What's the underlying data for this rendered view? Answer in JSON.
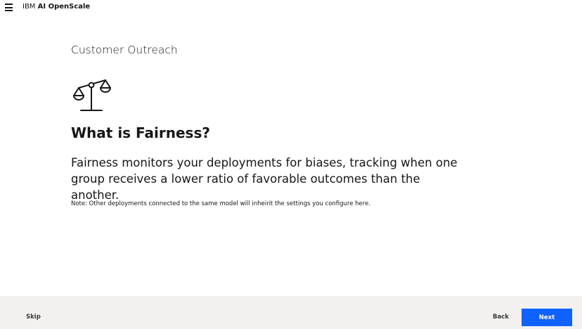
{
  "header": {
    "brand_prefix": "IBM",
    "brand_name": "AI OpenScale",
    "menu_icon": "hamburger-menu-icon"
  },
  "main": {
    "subtitle": "Customer Outreach",
    "icon": "balance-scale-icon",
    "heading": "What is Fairness?",
    "description": "Fairness monitors your deployments for biases, tracking when one group receives a lower ratio of favorable outcomes than the another.",
    "note": "Note: Other deployments connected to the same model will inheirit the settings you configure here."
  },
  "footer": {
    "skip_label": "Skip",
    "back_label": "Back",
    "next_label": "Next"
  },
  "colors": {
    "primary_button": "#0f62fe",
    "footer_background": "#f2f1f0",
    "text": "#161616"
  }
}
